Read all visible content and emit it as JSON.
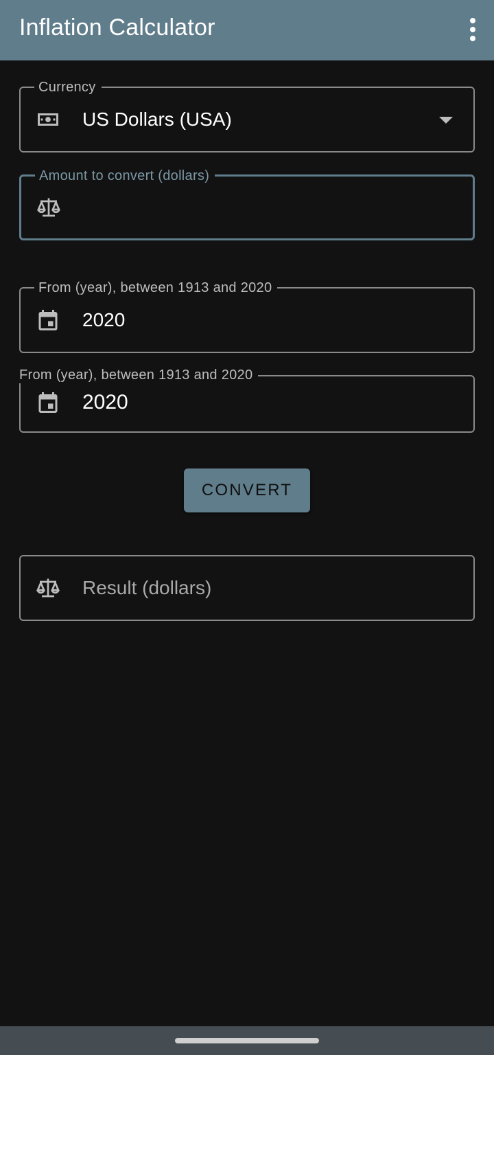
{
  "app_bar": {
    "title": "Inflation Calculator",
    "menu_icon": "more-vert-icon"
  },
  "currency_field": {
    "label": "Currency",
    "value": "US Dollars (USA)",
    "icon": "money-icon"
  },
  "amount_field": {
    "label": "Amount to convert (dollars)",
    "value": "",
    "icon": "scale-icon"
  },
  "from_year_field": {
    "label": "From (year), between 1913 and 2020",
    "value": "2020",
    "icon": "calendar-icon"
  },
  "to_year_field": {
    "label": "From (year), between 1913 and 2020",
    "value": "2020",
    "icon": "calendar-icon"
  },
  "convert_button": {
    "label": "CONVERT"
  },
  "result_field": {
    "placeholder": "Result (dollars)",
    "icon": "scale-icon"
  },
  "colors": {
    "primary": "#607d8b",
    "background": "#121212",
    "outline": "#8a8a8a",
    "nav_bar": "#454d52"
  }
}
